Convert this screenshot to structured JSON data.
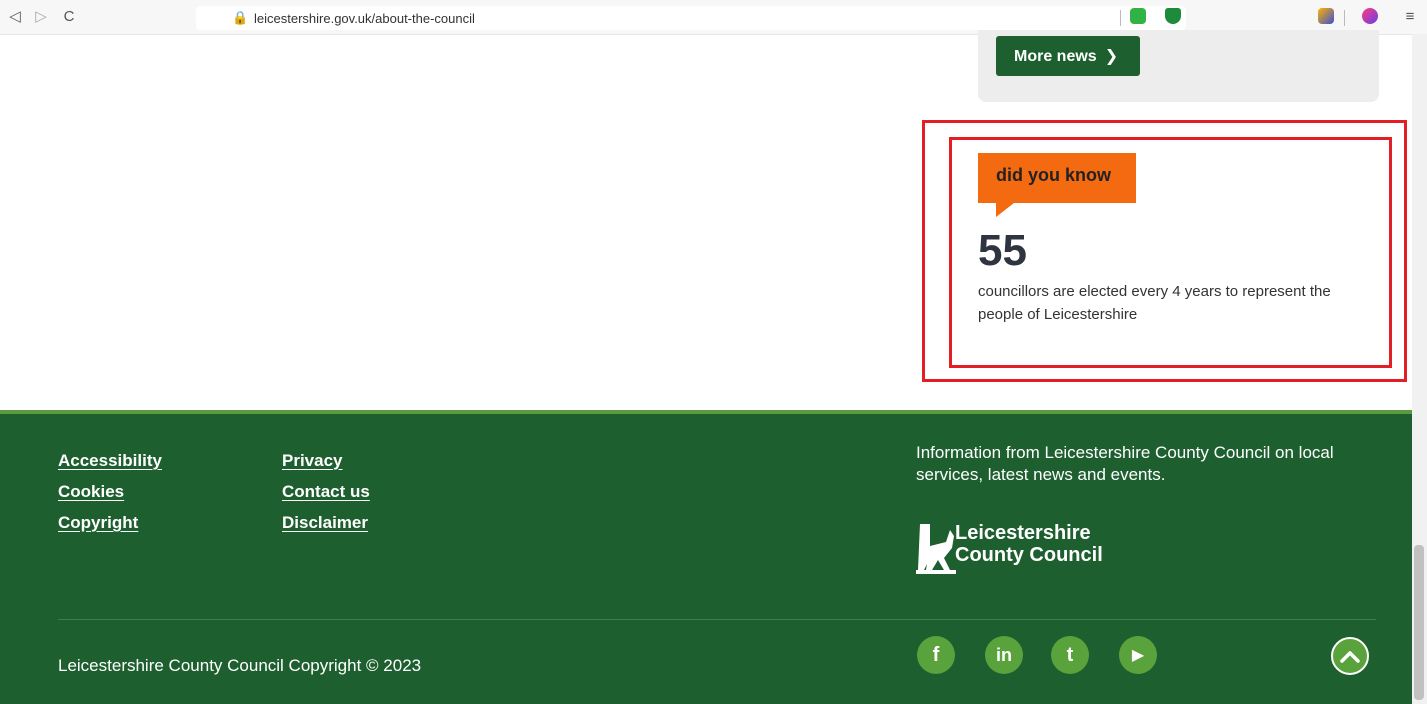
{
  "browser": {
    "url": "leicestershire.gov.uk/about-the-council",
    "back_icon": "back-arrow-icon",
    "forward_icon": "forward-arrow-icon",
    "reload_icon": "reload-icon",
    "bookmark_icon": "bookmark-icon",
    "lock_icon": "lock-icon"
  },
  "news": {
    "more_news_label": "More news"
  },
  "did_you_know": {
    "tag": "did you know",
    "number": "55",
    "text": "councillors are elected every 4 years to represent the people of Leicestershire"
  },
  "footer": {
    "links_col1": [
      "Accessibility",
      "Cookies",
      "Copyright"
    ],
    "links_col2": [
      "Privacy",
      "Contact us",
      "Disclaimer"
    ],
    "info": "Information from Leicestershire County Council on local services, latest news and events.",
    "logo_line1": "Leicestershire",
    "logo_line2": "County Council",
    "copyright": "Leicestershire County Council Copyright © 2023",
    "social": [
      "facebook-icon",
      "linkedin-icon",
      "twitter-icon",
      "youtube-icon"
    ],
    "social_glyphs": [
      "f",
      "in",
      "t",
      "▶"
    ]
  },
  "colors": {
    "footer_bg": "#1d5f2f",
    "accent_green": "#5aa33c",
    "dyk_orange": "#f46a11",
    "highlight_red": "#e31e24"
  }
}
